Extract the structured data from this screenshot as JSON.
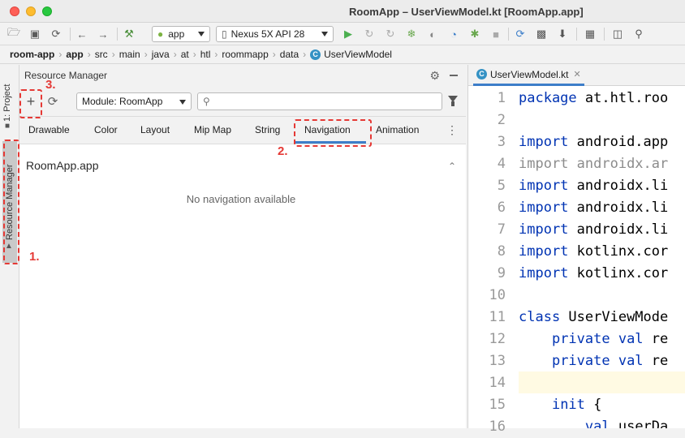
{
  "window": {
    "title": "RoomApp – UserViewModel.kt [RoomApp.app]"
  },
  "toolbar": {
    "run_config": "app",
    "device": "Nexus 5X API 28"
  },
  "breadcrumb": [
    "room-app",
    "app",
    "src",
    "main",
    "java",
    "at",
    "htl",
    "roommapp",
    "data",
    "UserViewModel"
  ],
  "sidestrip": {
    "project_label": "1: Project",
    "resource_manager_label": "Resource Manager"
  },
  "resource_manager": {
    "title": "Resource Manager",
    "module_select": "Module: RoomApp",
    "search_placeholder": "",
    "tabs": [
      "Drawable",
      "Color",
      "Layout",
      "Mip Map",
      "String",
      "Navigation",
      "Animation"
    ],
    "active_tab": "Navigation",
    "section_title": "RoomApp.app",
    "empty_message": "No navigation available"
  },
  "annotations": [
    "1.",
    "2.",
    "3."
  ],
  "editor": {
    "tab_label": "UserViewModel.kt",
    "line_numbers": [
      "1",
      "2",
      "3",
      "4",
      "5",
      "6",
      "7",
      "8",
      "9",
      "10",
      "11",
      "12",
      "13",
      "14",
      "15",
      "16"
    ],
    "lines": [
      "package at.htl.roo",
      "",
      "import android.app",
      "import androidx.ar",
      "import androidx.li",
      "import androidx.li",
      "import androidx.li",
      "import kotlinx.cor",
      "import kotlinx.cor",
      "",
      "class UserViewMode",
      "    private val re",
      "    private val re",
      "",
      "    init {",
      "        val userDa"
    ]
  },
  "colors": {
    "accent": "#3d7ec9",
    "callout": "#e53935",
    "keyword": "#0033b3"
  }
}
